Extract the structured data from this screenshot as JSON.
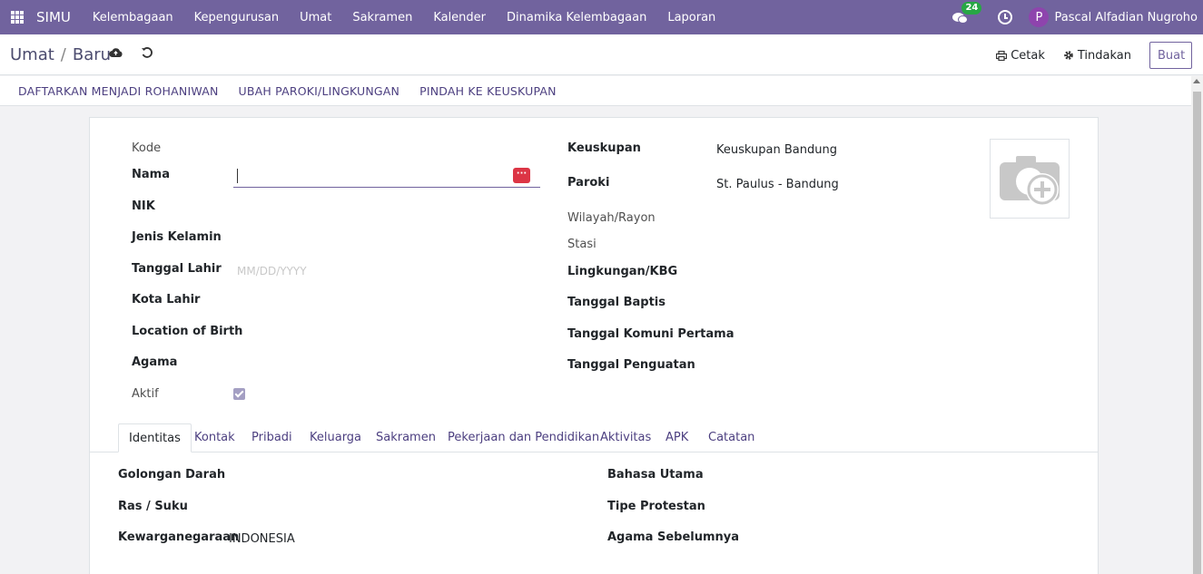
{
  "navbar": {
    "brand": "SIMU",
    "menu": [
      "Kelembagaan",
      "Kepengurusan",
      "Umat",
      "Sakramen",
      "Kalender",
      "Dinamika Kelembagaan",
      "Laporan"
    ],
    "chat_count": "24",
    "avatar_letter": "P",
    "username": "Pascal Alfadian Nugroho",
    "accent_color": "#71639e"
  },
  "control_panel": {
    "breadcrumb_parent": "Umat",
    "breadcrumb_sep": "/",
    "breadcrumb_current": "Baru",
    "print_label": "Cetak",
    "action_label": "Tindakan",
    "create_label": "Buat"
  },
  "status_buttons": [
    "DAFTARKAN MENJADI ROHANIWAN",
    "UBAH PAROKI/LINGKUNGAN",
    "PINDAH KE KEUSKUPAN"
  ],
  "form": {
    "left": {
      "kode": "Kode",
      "nama": "Nama",
      "nik": "NIK",
      "jenis_kelamin": "Jenis Kelamin",
      "tanggal_lahir": "Tanggal Lahir",
      "tanggal_lahir_placeholder": "MM/DD/YYYY",
      "kota_lahir": "Kota Lahir",
      "location_of_birth": "Location of Birth",
      "agama": "Agama",
      "aktif": "Aktif"
    },
    "right": {
      "keuskupan": "Keuskupan",
      "keuskupan_value": "Keuskupan Bandung",
      "paroki": "Paroki",
      "paroki_value": "St. Paulus - Bandung",
      "wilayah": "Wilayah/Rayon",
      "stasi": "Stasi",
      "lingkungan": "Lingkungan/KBG",
      "tanggal_baptis": "Tanggal Baptis",
      "tanggal_komuni": "Tanggal Komuni Pertama",
      "tanggal_penguatan": "Tanggal Penguatan"
    },
    "dots_label": "···"
  },
  "tabs": [
    "Identitas",
    "Kontak",
    "Pribadi",
    "Keluarga",
    "Sakramen",
    "Pekerjaan dan Pendidikan",
    "Aktivitas",
    "APK",
    "Catatan"
  ],
  "identitas": {
    "golongan_darah": "Golongan Darah",
    "ras_suku": "Ras / Suku",
    "kewarganegaraan": "Kewarganegaraan",
    "kewarganegaraan_value": "INDONESIA",
    "bahasa_utama": "Bahasa Utama",
    "tipe_protestan": "Tipe Protestan",
    "agama_sebelumnya": "Agama Sebelumnya"
  }
}
